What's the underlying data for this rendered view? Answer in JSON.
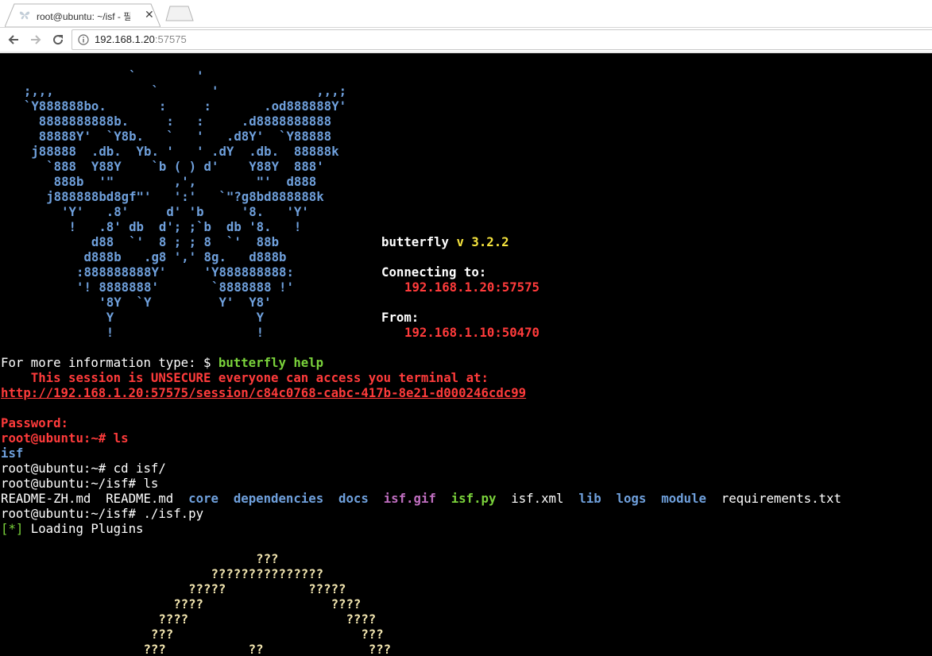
{
  "browser": {
    "tab_title": "root@ubuntu: ~/isf - 필",
    "url_host": "192.168.1.20",
    "url_port": ":57575"
  },
  "terminal": {
    "butterfly_art": [
      "                `        '",
      "  ;,,,             `       '             ,,,;",
      "  `Y888888bo.       :     :       .od888888Y'",
      "    8888888888b.     :   :     .d8888888888",
      "    88888Y'  `Y8b.   `   '   .d8Y'  `Y88888",
      "   j88888  .db.  Yb. '   ' .dY  .db.  88888k",
      "     `888  Y88Y    `b ( ) d'    Y88Y  888'",
      "      888b  '\"        ,',        \"'  d888",
      "     j888888bd8gf\"'   ':'   `\"?g8bd888888k",
      "       'Y'   .8'     d' 'b     '8.   'Y'",
      "        !   .8' db  d'; ;`b  db '8.   !",
      "           d88  `'  8 ; ; 8  `'  88b",
      "          d888b   .g8 ',' 8g.   d888b",
      "         :888888888Y'     'Y888888888:",
      "         '! 8888888'       `8888888 !'",
      "            '8Y  `Y         Y'  Y8'",
      "             Y                   Y",
      "             !                   !"
    ],
    "info": {
      "app_name": "butterfly",
      "version_prefix": "v",
      "version": "3.2.2",
      "connecting_label": "Connecting to:",
      "connecting_addr": "192.168.1.20:57575",
      "from_label": "From:",
      "from_addr": "192.168.1.10:50470"
    },
    "help_prefix": "For more information type: $ ",
    "help_cmd": "butterfly help",
    "unsecure_msg": "    This session is UNSECURE everyone can access you terminal at:",
    "session_url": "http://192.168.1.20:57575/session/c84c0768-cabc-417b-8e21-d000246cdc99",
    "password_prompt": "Password:",
    "prompt_home": "root@ubuntu:~#",
    "cmd1": " ls",
    "ls_home_output": "isf",
    "prompt_home2": "root@ubuntu:~#",
    "cmd2": " cd isf/",
    "prompt_isf": "root@ubuntu:~/isf#",
    "cmd3": " ls",
    "ls_isf_output": [
      {
        "text": "README-ZH.md",
        "color": "#ffffff",
        "bold": false
      },
      {
        "text": "README.md",
        "color": "#ffffff",
        "bold": false
      },
      {
        "text": "core",
        "color": "#6fa0dc",
        "bold": true
      },
      {
        "text": "dependencies",
        "color": "#6fa0dc",
        "bold": true
      },
      {
        "text": "docs",
        "color": "#6fa0dc",
        "bold": true
      },
      {
        "text": "isf.gif",
        "color": "#c06ec0",
        "bold": true
      },
      {
        "text": "isf.py",
        "color": "#7ad23b",
        "bold": true
      },
      {
        "text": "isf.xml",
        "color": "#ffffff",
        "bold": false
      },
      {
        "text": "lib",
        "color": "#6fa0dc",
        "bold": true
      },
      {
        "text": "logs",
        "color": "#6fa0dc",
        "bold": true
      },
      {
        "text": "module",
        "color": "#6fa0dc",
        "bold": true
      },
      {
        "text": "requirements.txt",
        "color": "#ffffff",
        "bold": false
      }
    ],
    "prompt_isf2": "root@ubuntu:~/isf#",
    "cmd4": " ./isf.py",
    "loading_marker": "[*]",
    "loading_text": " Loading Plugins",
    "isf_art": [
      "                                  ???",
      "                            ???????????????",
      "                         ?????           ?????",
      "                       ????                 ????",
      "                     ????                     ????",
      "                    ???                         ???",
      "                   ???           ??              ???"
    ]
  }
}
